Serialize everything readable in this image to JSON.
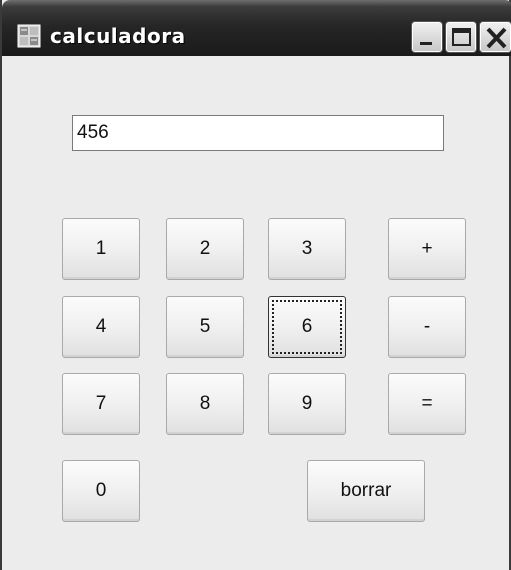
{
  "window": {
    "title": "calculadora",
    "icons": {
      "app": "calculator-window-icon",
      "minimize": "minimize-icon",
      "maximize": "maximize-icon",
      "close": "close-icon"
    }
  },
  "display": {
    "value": "456"
  },
  "keys": {
    "k1": "1",
    "k2": "2",
    "k3": "3",
    "plus": "+",
    "k4": "4",
    "k5": "5",
    "k6": "6",
    "minus": "-",
    "k7": "7",
    "k8": "8",
    "k9": "9",
    "equals": "=",
    "k0": "0",
    "clear": "borrar"
  },
  "state": {
    "focused_key": "6"
  }
}
